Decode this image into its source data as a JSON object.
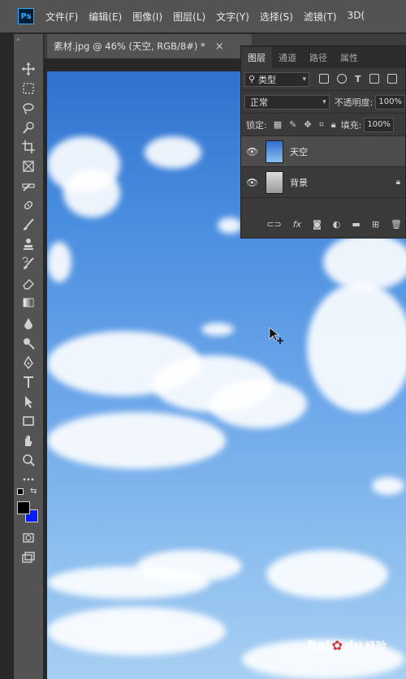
{
  "app": {
    "logo": "Ps",
    "menu": [
      "文件(F)",
      "编辑(E)",
      "图像(I)",
      "图层(L)",
      "文字(Y)",
      "选择(S)",
      "滤镜(T)",
      "3D("
    ]
  },
  "document": {
    "tab_title": "素材.jpg @ 46% (天空, RGB/8#) *",
    "close_glyph": "×"
  },
  "toolbar": {
    "grip": "»",
    "tools": [
      "move-tool",
      "marquee-tool",
      "lasso-tool",
      "quick-select-tool",
      "crop-tool",
      "frame-tool",
      "eyedropper-tool",
      "healing-brush-tool",
      "brush-tool",
      "clone-stamp-tool",
      "history-brush-tool",
      "eraser-tool",
      "gradient-tool",
      "blur-tool",
      "dodge-tool",
      "pen-tool",
      "type-tool",
      "path-select-tool",
      "rectangle-tool",
      "hand-tool",
      "zoom-tool",
      "more-tools"
    ],
    "foreground_color": "#000000",
    "background_color": "#0a1bff"
  },
  "layers_panel": {
    "tabs": [
      {
        "label": "图层",
        "active": true
      },
      {
        "label": "通道",
        "active": false
      },
      {
        "label": "路径",
        "active": false
      },
      {
        "label": "属性",
        "active": false
      }
    ],
    "filter_label": "类型",
    "blend_mode": "正常",
    "opacity_label": "不透明度:",
    "opacity_value": "100%",
    "lock_label": "锁定:",
    "fill_label": "填充:",
    "fill_value": "100%",
    "layers": [
      {
        "name": "天空",
        "visible": true,
        "selected": true,
        "locked": false
      },
      {
        "name": "背景",
        "visible": true,
        "selected": false,
        "locked": true
      }
    ],
    "footer_icons": [
      "link-icon",
      "fx-icon",
      "mask-icon",
      "adjustment-icon",
      "folder-icon",
      "new-layer-icon",
      "trash-icon"
    ],
    "fx_label": "fx"
  },
  "watermark": {
    "brand": "Bai",
    "brand2": "du",
    "suffix": "经验"
  }
}
